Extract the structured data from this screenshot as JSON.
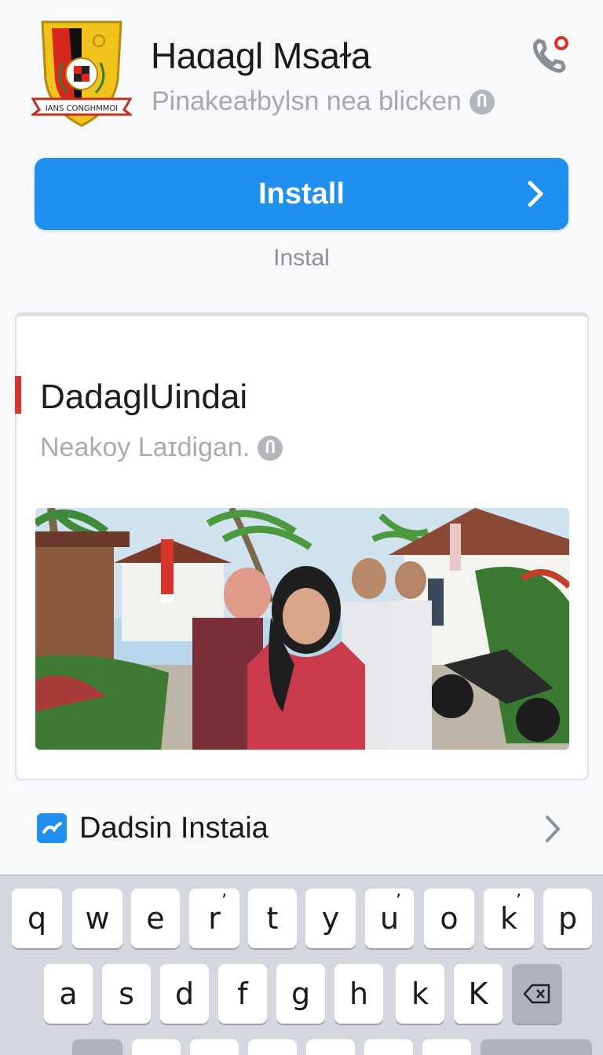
{
  "header": {
    "app_name": "Ηaɑagl Msaɫa",
    "subtitle": "Pinakeaɫbylsn nea blicken",
    "info_glyph": "Ⴖ",
    "logo_banner_text": "ΙΑΝS ϹΟΝGΗΜΜΟΙ"
  },
  "install": {
    "button_label": "Install",
    "sub_label": "Instal"
  },
  "card": {
    "title": "DadaglUindai",
    "subtitle": "Neakoy Laɪdigan.",
    "info_glyph": "Ⴖ"
  },
  "row": {
    "label": "Dadsin Instaia"
  },
  "keyboard": {
    "row1": [
      "q",
      "w",
      "e",
      "r",
      "t",
      "y",
      "u",
      "o",
      "k",
      "p"
    ],
    "row1_marks": [
      "",
      "",
      "",
      "’",
      "",
      "",
      "’",
      "",
      "’",
      ""
    ],
    "row2": [
      "a",
      "s",
      "d",
      "f",
      "g",
      "h",
      "k",
      "K"
    ]
  },
  "colors": {
    "accent": "#1f8ff0",
    "indicator_red": "#d9342b",
    "muted_text": "#a6a8ad"
  }
}
